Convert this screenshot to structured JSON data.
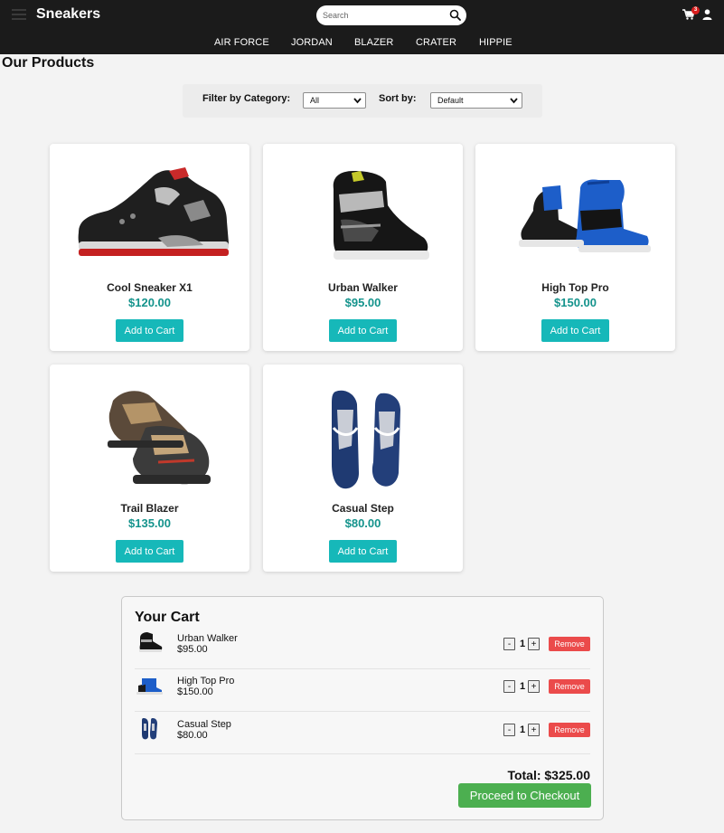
{
  "header": {
    "brand": "Sneakers",
    "search_placeholder": "Search",
    "cart_count": "3",
    "nav": [
      "AIR FORCE",
      "JORDAN",
      "BLAZER",
      "CRATER",
      "HIPPIE"
    ]
  },
  "page_title": "Our Products",
  "filters": {
    "category_label": "Filter by Category:",
    "category_value": "All",
    "sort_label": "Sort by:",
    "sort_value": "Default"
  },
  "products": [
    {
      "name": "Cool Sneaker X1",
      "price": "$120.00",
      "button": "Add to Cart"
    },
    {
      "name": "Urban Walker",
      "price": "$95.00",
      "button": "Add to Cart"
    },
    {
      "name": "High Top Pro",
      "price": "$150.00",
      "button": "Add to Cart"
    },
    {
      "name": "Trail Blazer",
      "price": "$135.00",
      "button": "Add to Cart"
    },
    {
      "name": "Casual Step",
      "price": "$80.00",
      "button": "Add to Cart"
    }
  ],
  "cart": {
    "title": "Your Cart",
    "items": [
      {
        "name": "Urban Walker",
        "price": "$95.00",
        "qty": "1",
        "minus": "-",
        "plus": "+",
        "remove": "Remove"
      },
      {
        "name": "High Top Pro",
        "price": "$150.00",
        "qty": "1",
        "minus": "-",
        "plus": "+",
        "remove": "Remove"
      },
      {
        "name": "Casual Step",
        "price": "$80.00",
        "qty": "1",
        "minus": "-",
        "plus": "+",
        "remove": "Remove"
      }
    ],
    "total": "Total: $325.00",
    "checkout": "Proceed to Checkout"
  },
  "colors": {
    "header_bg": "#1b1b1b",
    "accent_teal": "#16b8b9",
    "price_teal": "#14938c",
    "remove_red": "#eb4b4b",
    "checkout_green": "#4caf50",
    "badge_red": "#d81e1e"
  },
  "icons": [
    "menu-icon",
    "search-icon",
    "cart-icon",
    "user-icon",
    "chevron-down-icon"
  ]
}
